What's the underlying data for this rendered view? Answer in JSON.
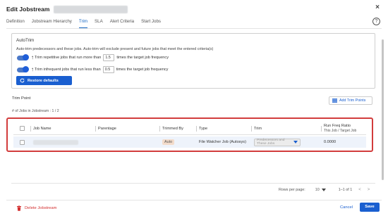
{
  "dialog": {
    "title": "Edit Jobstream",
    "close_glyph": "×",
    "help_glyph": "?"
  },
  "tabs": [
    {
      "label": "Definition",
      "active": false
    },
    {
      "label": "Jobstream Hierarchy",
      "active": false
    },
    {
      "label": "Trim",
      "active": true
    },
    {
      "label": "SLA",
      "active": false
    },
    {
      "label": "Alert Criteria",
      "active": false
    },
    {
      "label": "Start Jobs",
      "active": false
    }
  ],
  "autotrim": {
    "title": "AutoTrim",
    "description": "Auto-trim predecessors and these jobs. Auto-trim will exclude present and future jobs that meet the entered criteria(s)",
    "row1": {
      "prefix": "Trim repetitive jobs that run more than",
      "value": "1.5",
      "suffix": "times the target job frequency",
      "enabled": true
    },
    "row2": {
      "prefix": "Trim infrequent jobs that run less than",
      "value": "0.5",
      "suffix": "times the target job frequency",
      "enabled": true
    },
    "restore_label": "Restore defaults"
  },
  "trim_point": {
    "title": "Trim Point",
    "add_label": "Add Trim Points",
    "jobs_count": "# of Jobs in Jobstream : 1 / 2"
  },
  "grid": {
    "headers": {
      "job_name": "Job Name",
      "parentage": "Parentage",
      "trimmed_by": "Trimmed By",
      "type": "Type",
      "trim": "Trim",
      "run_freq_title": "Run Freq Ratio",
      "run_freq_sub": "This Job / Target Job"
    },
    "rows": [
      {
        "trimmed_by": "Auto",
        "type": "File Watcher Job (Autosys)",
        "trim": "Predecessors and These Jobs",
        "run_freq": "0.0000"
      }
    ]
  },
  "pager": {
    "rows_label": "Rows per page:",
    "rows_value": "10",
    "range": "1–1 of 1",
    "prev": "<",
    "next": ">"
  },
  "footer": {
    "delete_label": "Delete Jobstream",
    "cancel_label": "Cancel",
    "save_label": "Save"
  },
  "colors": {
    "accent": "#1a5fd0",
    "danger": "#d32f2f",
    "highlight_frame": "#d23c3c",
    "auto_badge": "#f3dccb"
  }
}
